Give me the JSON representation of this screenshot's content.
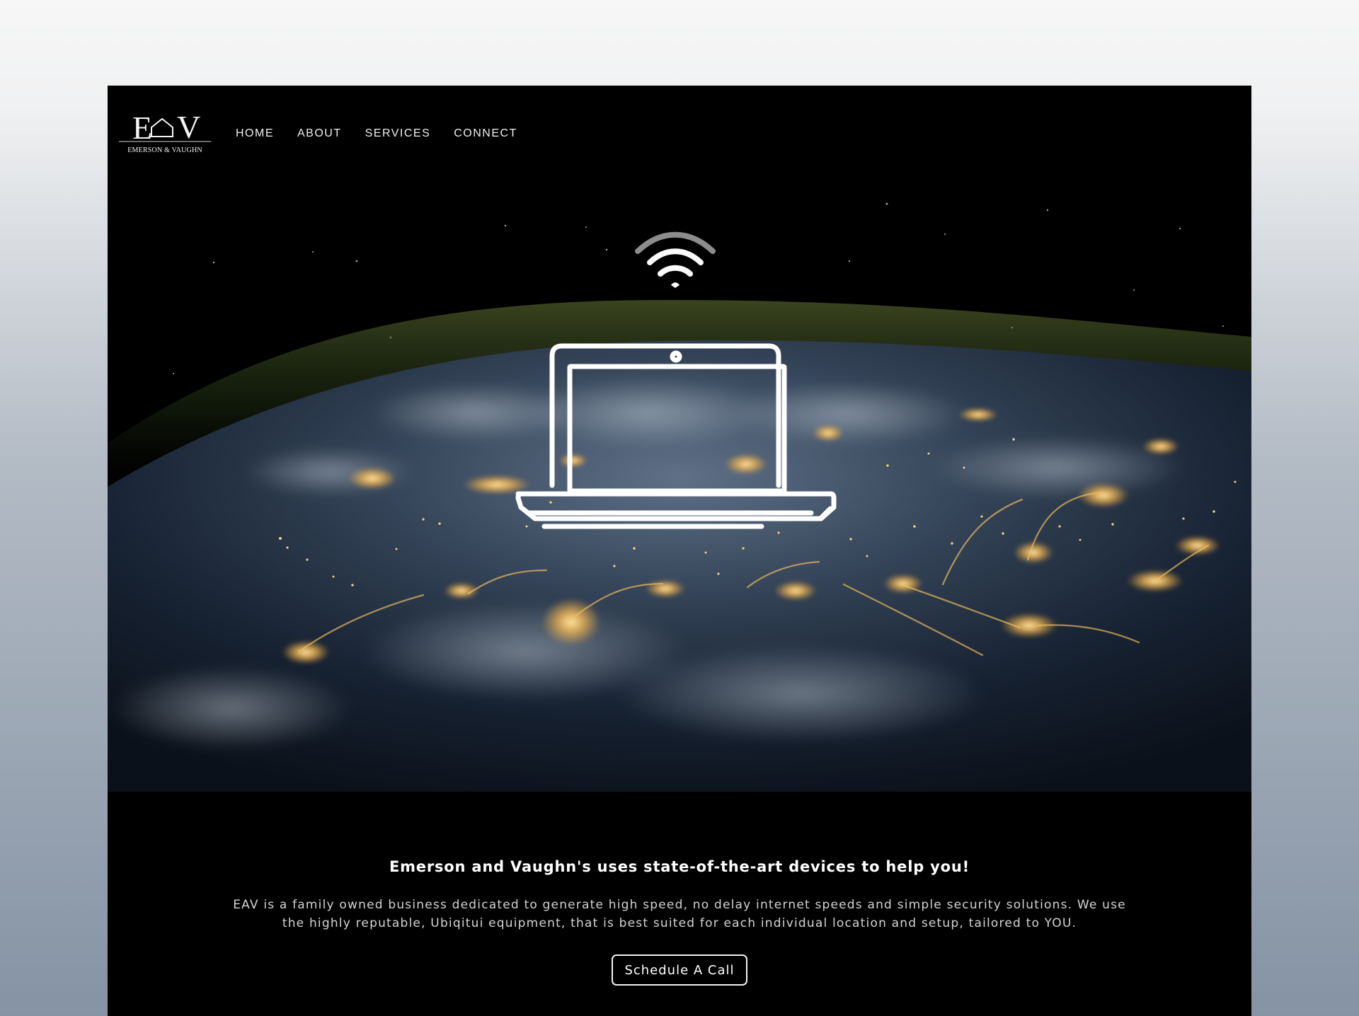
{
  "window": {
    "title": "Emerson and Vaughn"
  },
  "brand": {
    "monogram": "EAV",
    "tagline": "EMERSON & VAUGHN"
  },
  "nav": {
    "items": [
      {
        "label": "HOME"
      },
      {
        "label": "ABOUT"
      },
      {
        "label": "SERVICES"
      },
      {
        "label": "CONNECT"
      }
    ]
  },
  "hero": {
    "icons": [
      "wifi-icon",
      "laptop-icon"
    ]
  },
  "intro": {
    "heading": "Emerson and Vaughn's uses state-of-the-art devices to help you!",
    "body": "EAV is a family owned business dedicated to generate high speed, no delay internet speeds and simple security solutions. We use the highly reputable, Ubiqitui equipment, that is best suited for each individual location and setup, tailored to YOU.",
    "cta_label": "Schedule A Call"
  },
  "colors": {
    "background_outer": "#f0f1f2",
    "background_bottom": "#8593a4",
    "frame": "#000000",
    "text": "#ffffff",
    "muted_text": "#d4d4d4",
    "city_lights": "#f3c86b",
    "atmosphere": "#4b5a2d"
  }
}
